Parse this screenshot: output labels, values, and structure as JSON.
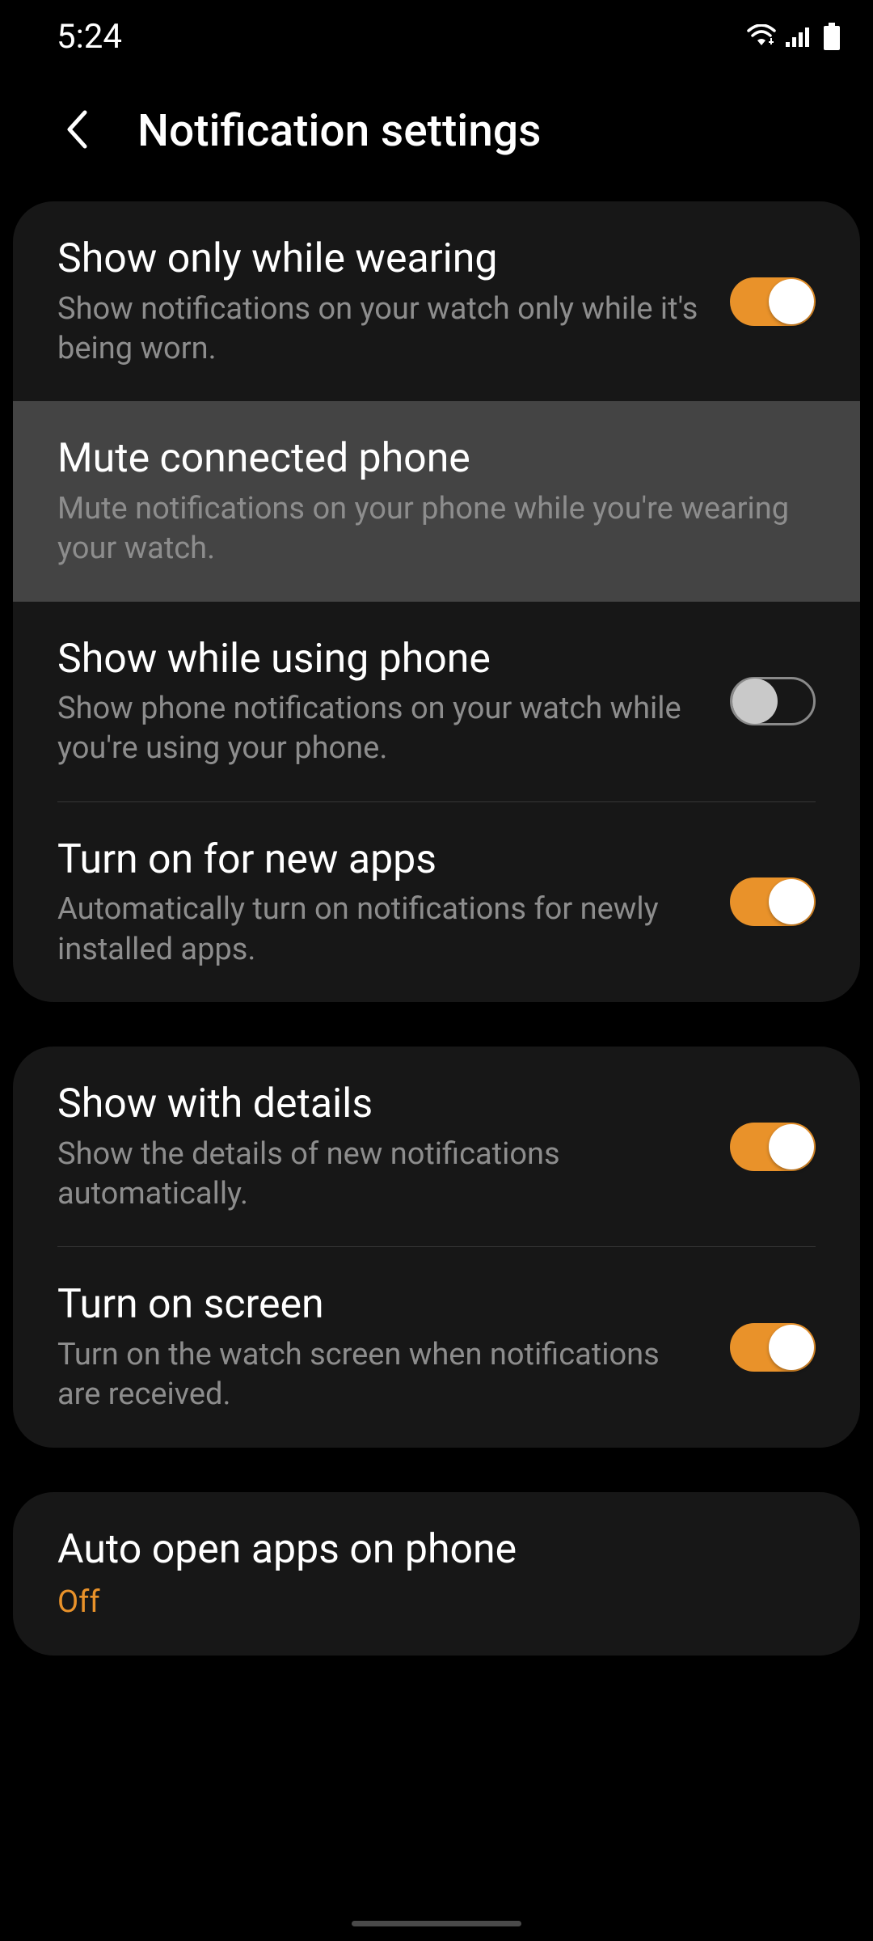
{
  "status": {
    "time": "5:24"
  },
  "header": {
    "title": "Notification settings"
  },
  "colors": {
    "accent": "#e9922a"
  },
  "groups": [
    {
      "items": [
        {
          "id": "show-only-wearing",
          "title": "Show only while wearing",
          "desc": "Show notifications on your watch only while it's being worn.",
          "toggle": "on"
        },
        {
          "id": "mute-connected-phone",
          "title": "Mute connected phone",
          "desc": "Mute notifications on your phone while you're wearing your watch.",
          "highlight": true
        },
        {
          "id": "show-while-using-phone",
          "title": "Show while using phone",
          "desc": "Show phone notifications on your watch while you're using your phone.",
          "toggle": "off"
        },
        {
          "id": "turn-on-new-apps",
          "title": "Turn on for new apps",
          "desc": "Automatically turn on notifications for newly installed apps.",
          "toggle": "on"
        }
      ]
    },
    {
      "items": [
        {
          "id": "show-with-details",
          "title": "Show with details",
          "desc": "Show the details of new notifications automatically.",
          "toggle": "on"
        },
        {
          "id": "turn-on-screen",
          "title": "Turn on screen",
          "desc": "Turn on the watch screen when notifications are received.",
          "toggle": "on"
        }
      ]
    },
    {
      "items": [
        {
          "id": "auto-open-apps",
          "title": "Auto open apps on phone",
          "value": "Off"
        }
      ]
    }
  ]
}
